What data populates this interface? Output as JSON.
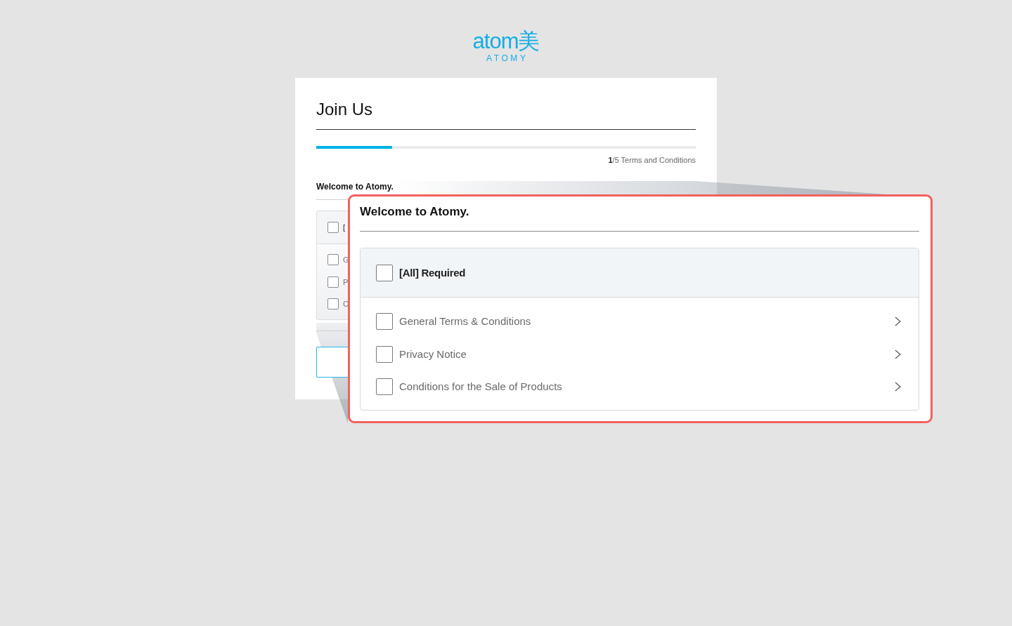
{
  "logo": {
    "wordmark": "atom美",
    "subtitle": "ATOMY"
  },
  "card": {
    "title": "Join Us",
    "progress": {
      "level": 0.2,
      "label": "**1**/5 Terms and Conditions"
    },
    "section_title": "Welcome to Atomy.",
    "select_all": {
      "label": "[",
      "checked": false
    },
    "items": [
      {
        "label": "G",
        "checked": false
      },
      {
        "label": "P",
        "checked": false
      },
      {
        "label": "C",
        "checked": false
      }
    ]
  },
  "magnified_view": {
    "title": "Welcome to Atomy.",
    "select_all": {
      "label": "[All] Required",
      "checked": false
    },
    "items": [
      {
        "label": "General Terms & Conditions",
        "checked": false
      },
      {
        "label": "Privacy Notice",
        "checked": false
      },
      {
        "label": "Conditions for the Sale of Products",
        "checked": false
      }
    ]
  }
}
